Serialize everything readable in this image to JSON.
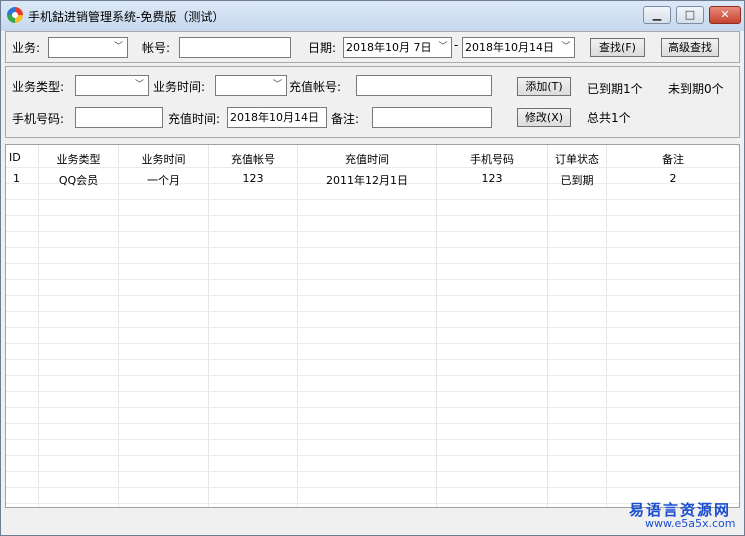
{
  "window": {
    "title": "手机鈷进销管理系统-免费版（测试）"
  },
  "search_bar": {
    "business_label": "业务:",
    "account_label": "帐号:",
    "account_value": "",
    "date_label": "日期:",
    "date_from": "2018年10月 7日",
    "date_separator": "-",
    "date_to": "2018年10月14日",
    "find_button": "查找(F)",
    "advanced_button": "高级查找"
  },
  "edit_form": {
    "business_type_label": "业务类型:",
    "business_time_label": "业务时间:",
    "recharge_account_label": "充值帐号:",
    "recharge_account_value": "",
    "add_button": "添加(T)",
    "expired_count": "已到期1个",
    "not_expired_count": "未到期0个",
    "phone_label": "手机号码:",
    "phone_value": "",
    "recharge_time_label": "充值时间:",
    "recharge_time_value": "2018年10月14日",
    "remark_label": "备注:",
    "remark_value": "",
    "modify_button": "修改(X)",
    "total_count": "总共1个"
  },
  "table": {
    "columns": [
      "ID",
      "业务类型",
      "业务时间",
      "充值帐号",
      "充值时间",
      "手机号码",
      "订单状态",
      "备注"
    ],
    "rows": [
      [
        "1",
        "QQ会员",
        "一个月",
        "123",
        "2011年12月1日",
        "123",
        "已到期",
        "2"
      ]
    ]
  },
  "watermark": {
    "text": "易语言资源网",
    "url": "www.e5a5x.com"
  }
}
